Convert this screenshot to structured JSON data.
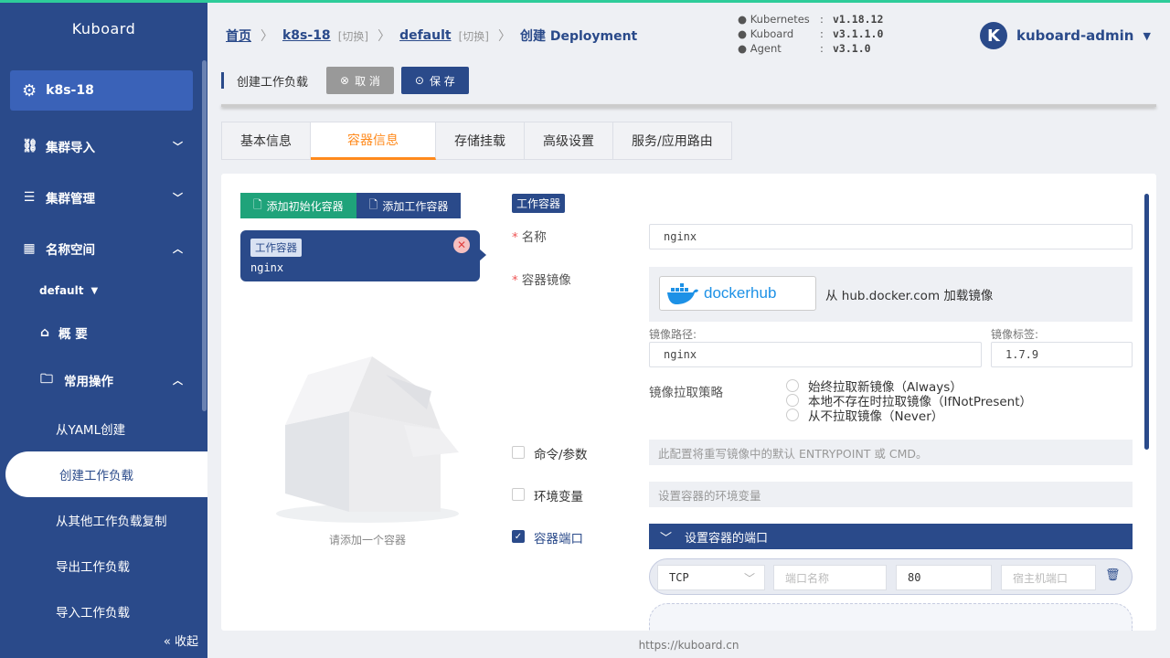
{
  "sidebar": {
    "brand": "Kuboard",
    "cluster": "k8s-18",
    "items": [
      {
        "label": "集群导入"
      },
      {
        "label": "集群管理"
      },
      {
        "label": "名称空间"
      }
    ],
    "namespace": "default",
    "overview": "概 要",
    "common_ops": "常用操作",
    "subs": [
      "从YAML创建",
      "创建工作负载",
      "从其他工作负载复制",
      "导出工作负载",
      "导入工作负载"
    ],
    "collapse": "收起"
  },
  "header": {
    "crumbs": {
      "home": "首页",
      "cluster": "k8s-18",
      "switch1": "[切换]",
      "ns": "default",
      "switch2": "[切换]",
      "current": "创建 Deployment"
    },
    "versions": [
      {
        "k": "Kubernetes",
        "v": "v1.18.12"
      },
      {
        "k": "Kuboard",
        "v": "v3.1.1.0"
      },
      {
        "k": "Agent",
        "v": "v3.1.0"
      }
    ],
    "user": "kuboard-admin",
    "avatar": "K"
  },
  "toolbar": {
    "title": "创建工作负载",
    "cancel": "取 消",
    "save": "保 存"
  },
  "tabs": [
    "基本信息",
    "容器信息",
    "存储挂载",
    "高级设置",
    "服务/应用路由"
  ],
  "containers": {
    "add_init": "添加初始化容器",
    "add_work": "添加工作容器",
    "card_tag": "工作容器",
    "card_name": "nginx",
    "empty_hint": "请添加一个容器"
  },
  "form": {
    "section_tag": "工作容器",
    "name_label": "名称",
    "name_value": "nginx",
    "image_label": "容器镜像",
    "docker_text": "从 hub.docker.com 加载镜像",
    "docker_logo_a": "docker",
    "docker_logo_b": "hub",
    "path_label": "镜像路径:",
    "path_value": "nginx",
    "tag_label": "镜像标签:",
    "tag_value": "1.7.9",
    "pull_label": "镜像拉取策略",
    "pull_options": [
      "始终拉取新镜像（Always）",
      "本地不存在时拉取镜像（IfNotPresent）",
      "从不拉取镜像（Never）"
    ],
    "cmd_label": "命令/参数",
    "cmd_hint": "此配置将重写镜像中的默认 ENTRYPOINT 或 CMD。",
    "env_label": "环境变量",
    "env_hint": "设置容器的环境变量",
    "port_label": "容器端口",
    "port_head": "设置容器的端口",
    "port_protocol": "TCP",
    "port_name_ph": "端口名称",
    "port_value": "80",
    "host_port_ph": "宿主机端口"
  },
  "footer": "https://kuboard.cn",
  "colors": {
    "primary": "#2a4a8a",
    "accent": "#ff8a1c",
    "green": "#1fa37a"
  }
}
